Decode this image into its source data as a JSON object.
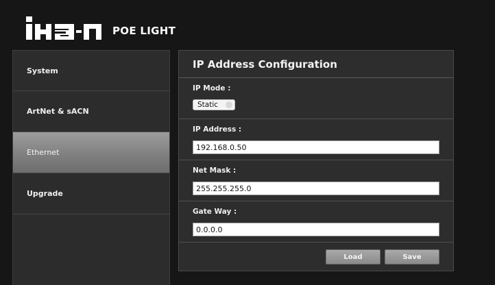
{
  "header": {
    "logo_text": "ikan",
    "logo_subtitle": "POE LIGHT"
  },
  "sidebar": {
    "items": [
      {
        "label": "System",
        "active": false
      },
      {
        "label": "ArtNet & sACN",
        "active": false
      },
      {
        "label": "Ethernet",
        "active": true
      },
      {
        "label": "Upgrade",
        "active": false
      }
    ]
  },
  "panel": {
    "title": "IP Address Configuration",
    "ip_mode": {
      "label": "IP Mode :",
      "selected": "Static"
    },
    "ip_address": {
      "label": "IP Address :",
      "value": "192.168.0.50"
    },
    "net_mask": {
      "label": "Net Mask :",
      "value": "255.255.255.0"
    },
    "gateway": {
      "label": "Gate Way :",
      "value": "0.0.0.0"
    },
    "buttons": {
      "load": "Load",
      "save": "Save"
    }
  },
  "colors": {
    "background": "#161616",
    "panel": "#2d2d2d",
    "active_nav": "#8a8a8a",
    "button": "#9a9a9a"
  }
}
